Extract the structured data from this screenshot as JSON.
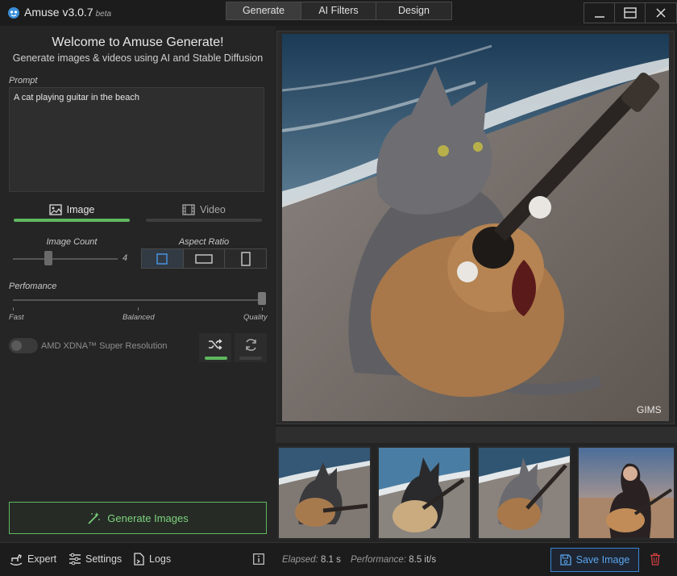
{
  "window": {
    "app_name": "Amuse v3.0.7",
    "beta_label": "beta",
    "tabs": [
      "Generate",
      "AI Filters",
      "Design"
    ],
    "active_tab": "Generate"
  },
  "left": {
    "welcome_title": "Welcome to Amuse Generate!",
    "welcome_subtitle": "Generate images & videos using AI and Stable Diffusion",
    "prompt_label": "Prompt",
    "prompt_value": "A cat playing guitar in the beach",
    "mode_image_label": "Image",
    "mode_video_label": "Video",
    "active_mode": "Image",
    "image_count_label": "Image Count",
    "image_count_value": "4",
    "aspect_ratio_label": "Aspect Ratio",
    "aspect_ratio_options": [
      "square",
      "landscape",
      "portrait"
    ],
    "aspect_ratio_selected": "square",
    "performance_label": "Perfomance",
    "performance_scale": [
      "Fast",
      "Balanced",
      "Quality"
    ],
    "performance_level": 1.0,
    "xdna_label": "AMD XDNA™ Super Resolution",
    "xdna_enabled": false,
    "generate_label": "Generate Images"
  },
  "bottom": {
    "expert_label": "Expert",
    "settings_label": "Settings",
    "logs_label": "Logs",
    "elapsed_label": "Elapsed:",
    "elapsed_value": "8.1 s",
    "performance_label": "Performance:",
    "performance_value": "8.5 it/s",
    "save_label": "Save Image"
  },
  "preview": {
    "watermark": "GIMS",
    "thumbnail_count": 4
  },
  "colors": {
    "accent_green": "#5fb85f",
    "accent_blue": "#3a86d6",
    "delete_red": "#d04040",
    "background": "#202020"
  }
}
